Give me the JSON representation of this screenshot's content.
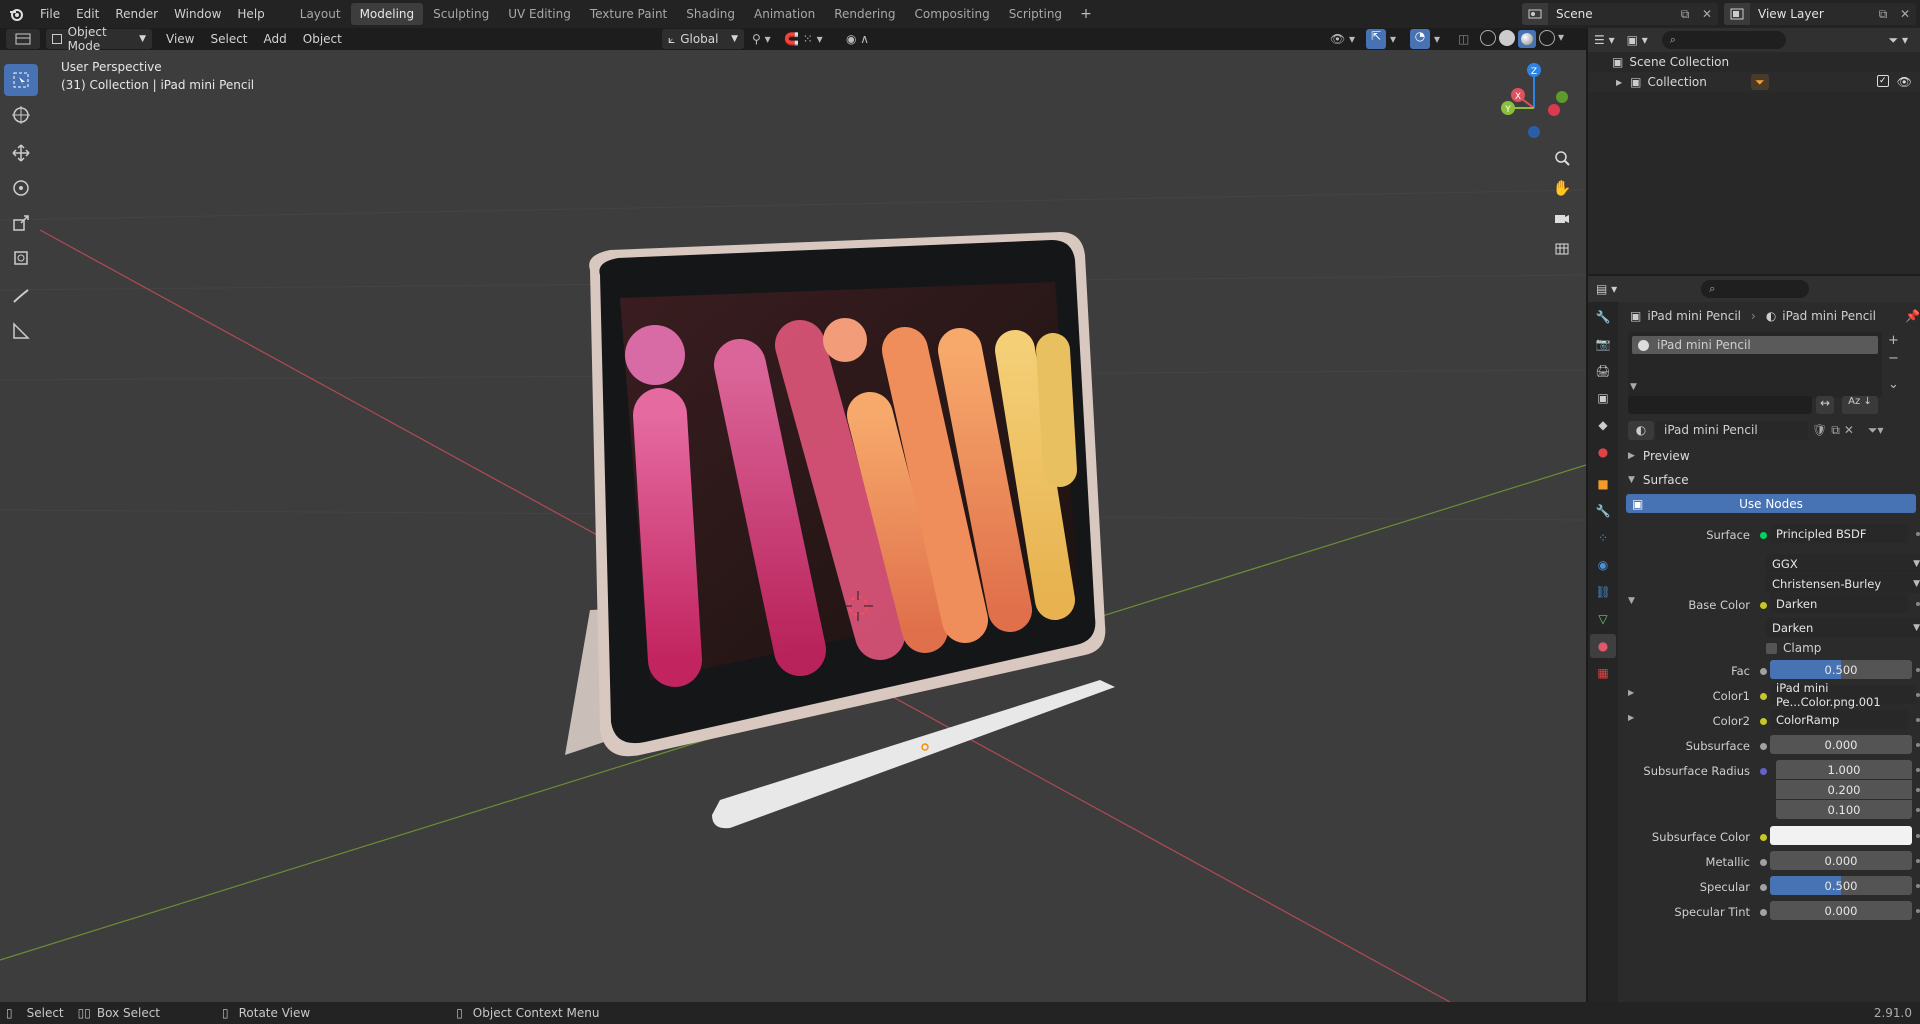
{
  "menu": [
    "File",
    "Edit",
    "Render",
    "Window",
    "Help"
  ],
  "workspaces": [
    "Layout",
    "Modeling",
    "Sculpting",
    "UV Editing",
    "Texture Paint",
    "Shading",
    "Animation",
    "Rendering",
    "Compositing",
    "Scripting"
  ],
  "active_workspace": "Modeling",
  "scene_name": "Scene",
  "view_layer": "View Layer",
  "viewport_header": {
    "mode": "Object Mode",
    "menus": [
      "View",
      "Select",
      "Add",
      "Object"
    ],
    "orientation": "Global"
  },
  "viewport": {
    "perspective": "User Perspective",
    "collection_info": "(31) Collection | iPad mini Pencil",
    "gizmo_axes": [
      "X",
      "Y",
      "Z"
    ]
  },
  "outliner": {
    "scene_collection": "Scene Collection",
    "collection": "Collection"
  },
  "properties": {
    "object_name": "iPad mini Pencil",
    "material_name": "iPad mini Pencil",
    "slot_name": "iPad mini Pencil",
    "material_datablock": "iPad mini Pencil",
    "panel_preview": "Preview",
    "panel_surface": "Surface",
    "use_nodes": "Use Nodes",
    "surface_label": "Surface",
    "surface_value": "Principled BSDF",
    "distribution": "GGX",
    "subsurface_method": "Christensen-Burley",
    "base_color_label": "Base Color",
    "base_color_value": "Darken",
    "blend_mode": "Darken",
    "clamp_label": "Clamp",
    "fac_label": "Fac",
    "fac_value": "0.500",
    "fac_fill": 0.5,
    "color1_label": "Color1",
    "color1_value": "iPad mini Pe...Color.png.001",
    "color2_label": "Color2",
    "color2_value": "ColorRamp",
    "subsurface_label": "Subsurface",
    "subsurface_value": "0.000",
    "subsurface_radius_label": "Subsurface Radius",
    "subsurface_radius": [
      "1.000",
      "0.200",
      "0.100"
    ],
    "subsurface_color_label": "Subsurface Color",
    "metallic_label": "Metallic",
    "metallic_value": "0.000",
    "specular_label": "Specular",
    "specular_value": "0.500",
    "specular_fill": 0.5,
    "specular_tint_label": "Specular Tint",
    "specular_tint_value": "0.000"
  },
  "statusbar": {
    "select": "Select",
    "box_select": "Box Select",
    "rotate_view": "Rotate View",
    "context_menu": "Object Context Menu",
    "version": "2.91.0"
  },
  "colors": {
    "accent": "#4772b3",
    "viewport_bg": "#3d3d3d",
    "x_axis": "#e04f5f",
    "y_axis": "#8bbe3a",
    "z_axis": "#2f83e3"
  }
}
